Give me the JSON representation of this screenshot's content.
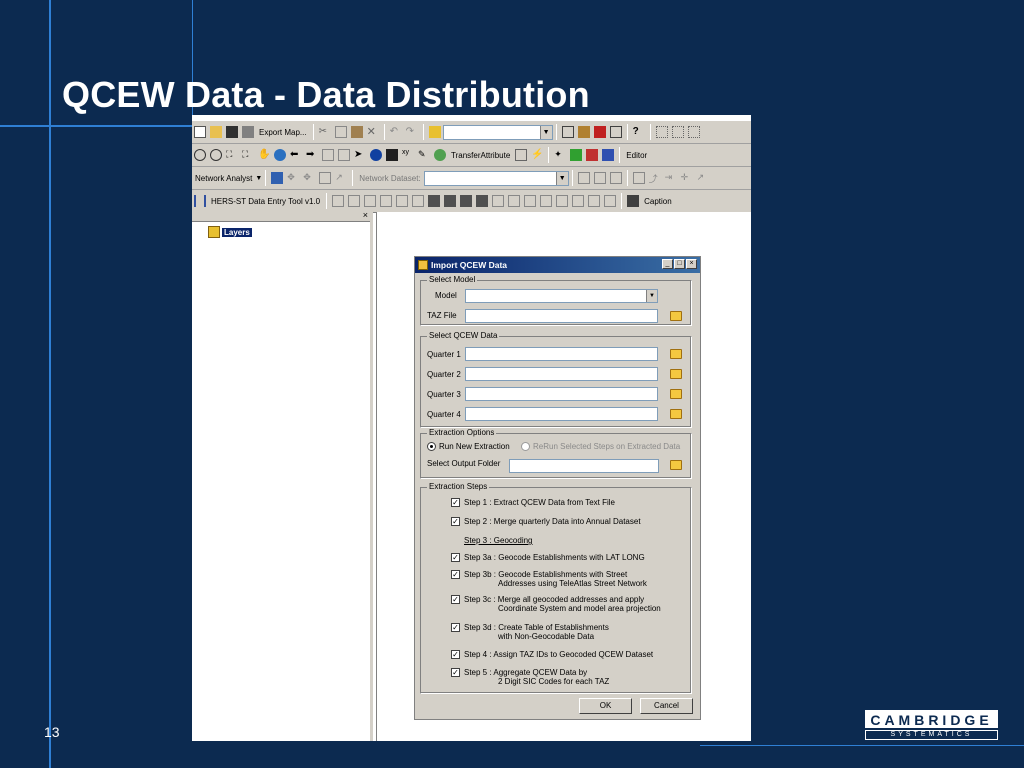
{
  "slide": {
    "title": "QCEW Data  - Data Distribution",
    "number": "13",
    "logo_top": "CAMBRIDGE",
    "logo_bottom": "SYSTEMATICS"
  },
  "toolbars": {
    "row1": {
      "export_map_label": "Export Map..."
    },
    "row2": {
      "transfer_attribute_label": "TransferAttribute",
      "editor_label": "Editor"
    },
    "row3": {
      "network_analyst_label": "Network Analyst",
      "network_dataset_label": "Network Dataset:"
    },
    "row4": {
      "hers_tool_label": "HERS-ST Data Entry Tool v1.0",
      "caption_label": "Caption"
    }
  },
  "toc": {
    "layers_label": "Layers"
  },
  "dialog": {
    "title": "Import QCEW Data",
    "select_model": {
      "group_label": "Select Model",
      "model_label": "Model",
      "model_value": "",
      "taz_file_label": "TAZ File",
      "taz_file_value": ""
    },
    "select_qcew": {
      "group_label": "Select QCEW Data",
      "quarters": [
        {
          "label": "Quarter 1",
          "value": ""
        },
        {
          "label": "Quarter 2",
          "value": ""
        },
        {
          "label": "Quarter 3",
          "value": ""
        },
        {
          "label": "Quarter 4",
          "value": ""
        }
      ]
    },
    "extraction_options": {
      "group_label": "Extraction Options",
      "run_new_label": "Run New Extraction",
      "rerun_label": "ReRun Selected Steps on Extracted Data",
      "output_folder_label": "Select Output Folder",
      "output_folder_value": ""
    },
    "extraction_steps": {
      "group_label": "Extraction Steps",
      "steps": [
        {
          "label": "Step 1   : Extract QCEW Data from Text File",
          "checked": true
        },
        {
          "label": "Step 2   : Merge quarterly Data into Annual Dataset",
          "checked": true
        },
        {
          "label": "Step 3   : Geocoding",
          "checked": false,
          "heading": true
        },
        {
          "label": "Step 3a : Geocode Establishments with LAT LONG",
          "checked": true
        },
        {
          "label": "Step 3b  : Geocode Establishments with Street",
          "label2": "Addresses using TeleAtlas Street Network",
          "checked": true
        },
        {
          "label": "Step 3c : Merge all geocoded addresses and apply",
          "label2": "Coordinate System and model area projection",
          "checked": true
        },
        {
          "label": "Step 3d  : Create Table of Establishments",
          "label2": "with Non-Geocodable Data",
          "checked": true
        },
        {
          "label": "Step 4   : Assign TAZ IDs to Geocoded QCEW Dataset",
          "checked": true
        },
        {
          "label": "Step 5   : Aggregate QCEW Data by",
          "label2": "2 Digit SIC Codes for each TAZ",
          "checked": true
        }
      ]
    },
    "ok_label": "OK",
    "cancel_label": "Cancel"
  }
}
